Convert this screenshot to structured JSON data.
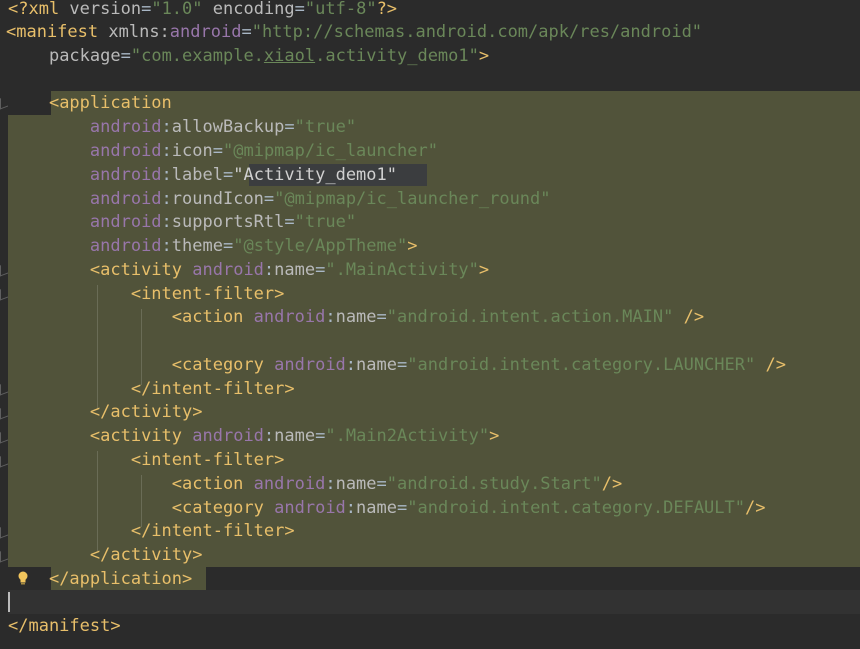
{
  "editor": {
    "xml_decl": {
      "open": "<?xml ",
      "attr1": "version",
      "val1": "\"1.0\"",
      "attr2": "encoding",
      "val2": "\"utf-8\"",
      "close": "?>"
    },
    "manifest": {
      "tag": "<manifest",
      "xmlns_attr": "xmlns:",
      "xmlns_prefix": "android",
      "xmlns_val": "\"http://schemas.android.com/apk/res/android\"",
      "package_attr": "package",
      "package_val_a": "\"com.example.",
      "package_val_u": "xiaol",
      "package_val_b": ".activity_demo1\"",
      "close_gt": ">",
      "end_tag": "</manifest>"
    },
    "application": {
      "tag": "<application",
      "attrs": [
        {
          "ns": "android",
          "name": "allowBackup",
          "value": "\"true\""
        },
        {
          "ns": "android",
          "name": "icon",
          "value": "\"@mipmap/ic_launcher\""
        },
        {
          "ns": "android",
          "name": "label",
          "value": "\"Activity_demo1\""
        },
        {
          "ns": "android",
          "name": "roundIcon",
          "value": "\"@mipmap/ic_launcher_round\""
        },
        {
          "ns": "android",
          "name": "supportsRtl",
          "value": "\"true\""
        },
        {
          "ns": "android",
          "name": "theme",
          "value": "\"@style/AppTheme\""
        }
      ],
      "end_tag": "</application>"
    },
    "activity1": {
      "tag": "<activity",
      "ns": "android",
      "attr": "name",
      "value": "\".MainActivity\"",
      "filter_open": "<intent-filter>",
      "action_tag": "<action",
      "action_value": "\"android.intent.action.MAIN\"",
      "category_tag": "<category",
      "category_value": "\"android.intent.category.LAUNCHER\"",
      "filter_close": "</intent-filter>",
      "end_tag": "</activity>"
    },
    "activity2": {
      "tag": "<activity",
      "ns": "android",
      "attr": "name",
      "value": "\".Main2Activity\"",
      "filter_open": "<intent-filter>",
      "action_tag": "<action",
      "action_value": "\"android.study.Start\"",
      "category_tag": "<category",
      "category_value": "\"android.intent.category.DEFAULT\"",
      "filter_close": "</intent-filter>",
      "end_tag": "</activity>"
    },
    "icons": {
      "gutter": "fold-marker-icon",
      "intention": "lightbulb-icon"
    },
    "colors": {
      "background": "#2b2b2b",
      "selection": "#51533a",
      "tag": "#e8bf6a",
      "namespace": "#9876aa",
      "attribute": "#bababa",
      "value": "#6a8759"
    }
  }
}
